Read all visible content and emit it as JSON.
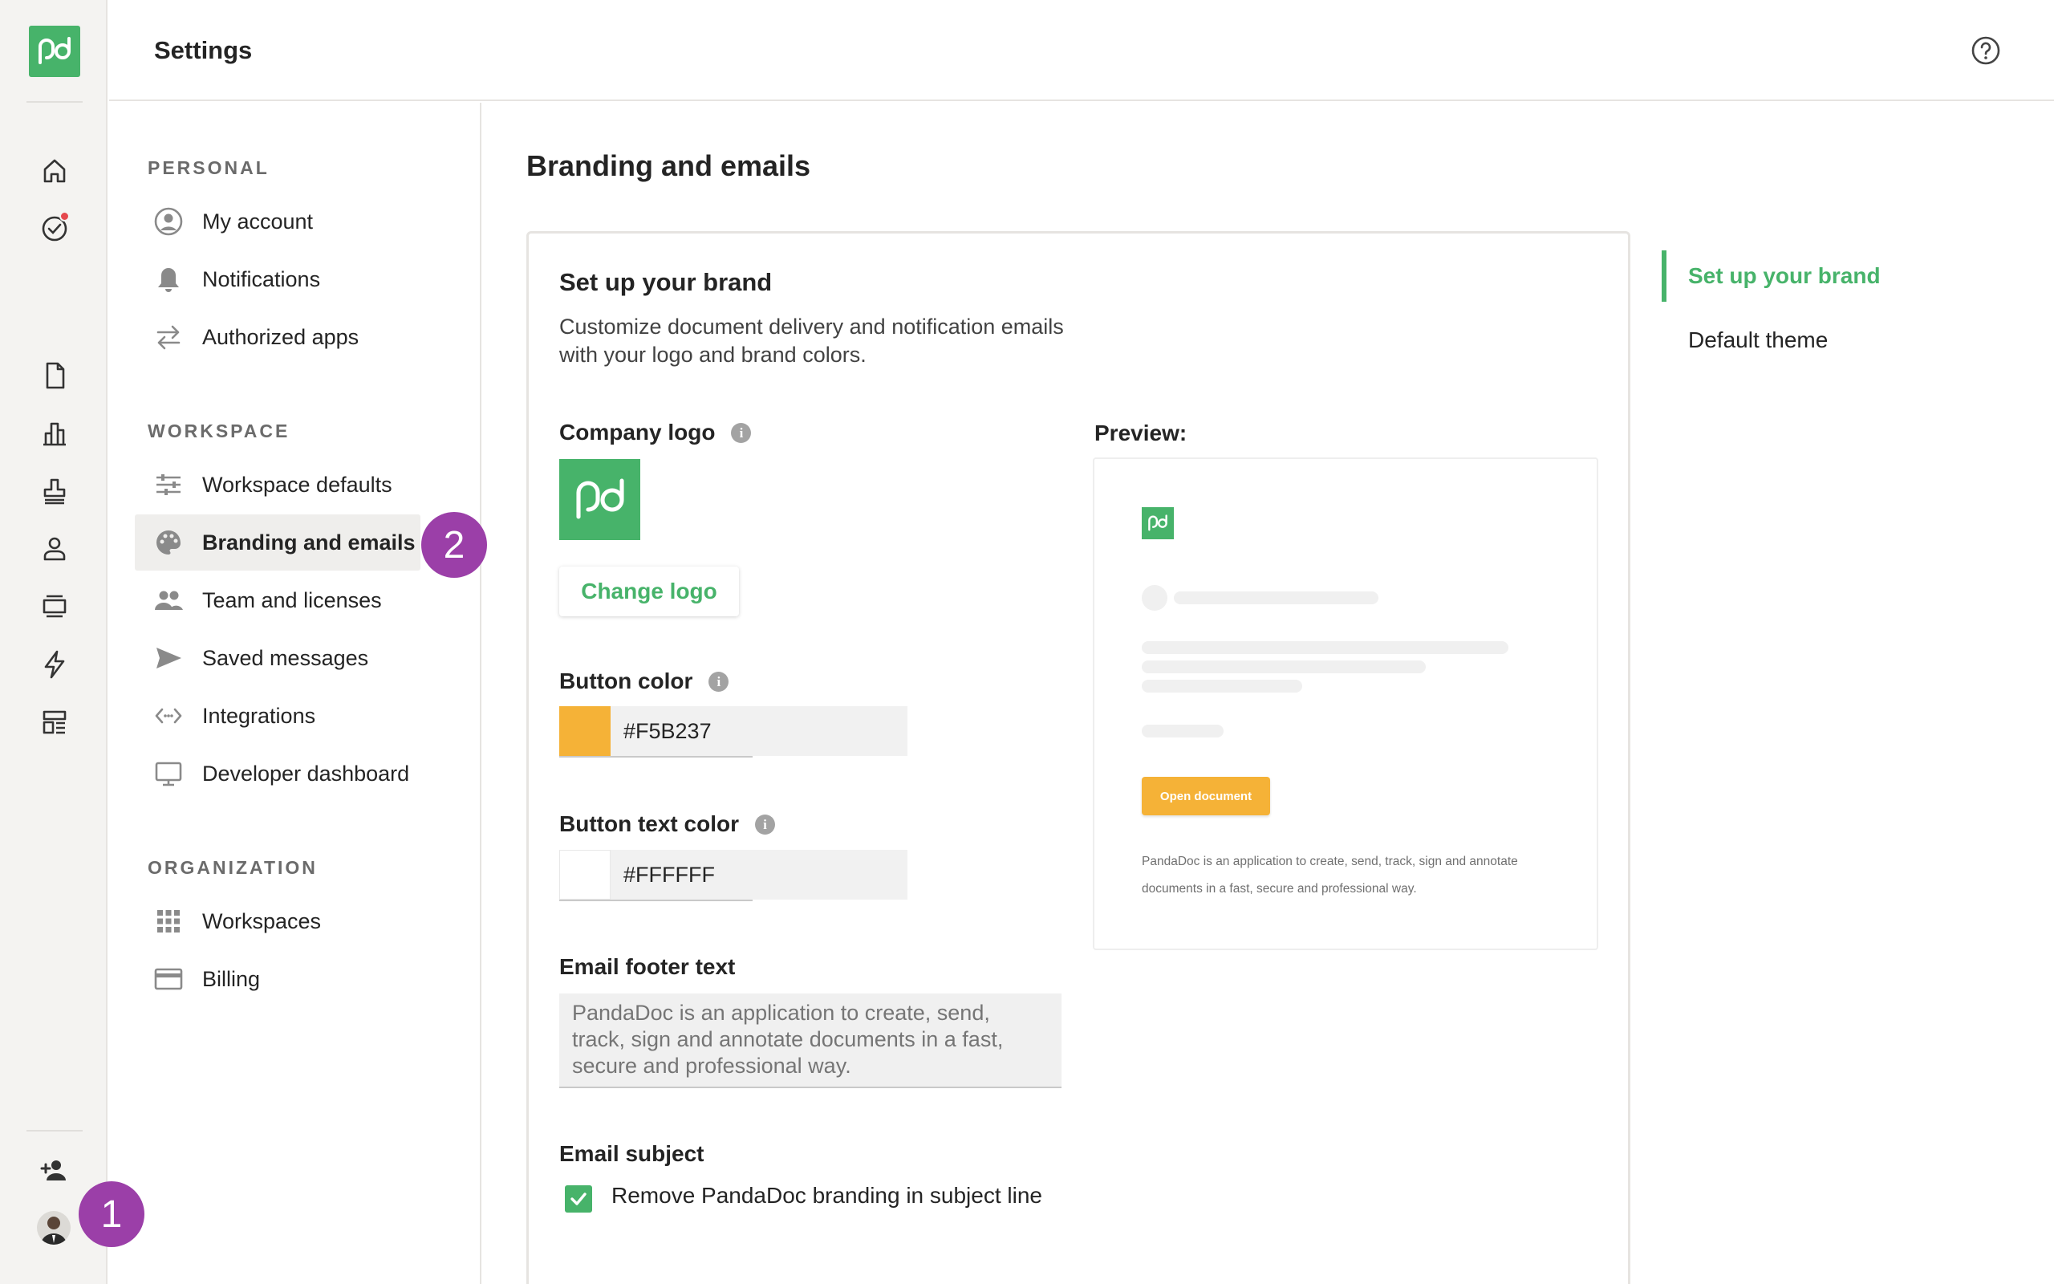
{
  "header": {
    "title": "Settings",
    "help_icon": "help-circle-icon"
  },
  "rail": {
    "items": [
      "home-icon",
      "tasks-icon",
      "documents-icon",
      "reports-icon",
      "stamp-icon",
      "contacts-icon",
      "catalog-icon",
      "automation-icon",
      "templates-icon"
    ],
    "invite_icon": "add-user-icon",
    "step_badge": "1"
  },
  "nav": {
    "personal_label": "PERSONAL",
    "personal_items": [
      "My account",
      "Notifications",
      "Authorized apps"
    ],
    "workspace_label": "WORKSPACE",
    "workspace_items": [
      "Workspace defaults",
      "Branding and emails",
      "Team and licenses",
      "Saved messages",
      "Integrations",
      "Developer dashboard"
    ],
    "organization_label": "ORGANIZATION",
    "organization_items": [
      "Workspaces",
      "Billing"
    ],
    "step_badge": "2",
    "active_item": "Branding and emails"
  },
  "main": {
    "title": "Branding and emails",
    "card": {
      "heading": "Set up your brand",
      "description": "Customize document delivery and notification emails with your logo and brand colors.",
      "company_logo_label": "Company logo",
      "change_logo_label": "Change logo",
      "button_color_label": "Button color",
      "button_color_value": "#F5B237",
      "button_text_color_label": "Button text color",
      "button_text_color_value": "#FFFFFF",
      "email_footer_label": "Email footer text",
      "email_footer_placeholder": "PandaDoc is an application to create, send, track, sign and annotate documents in a fast, secure and professional way.",
      "email_subject_label": "Email subject",
      "remove_branding_label": "Remove PandaDoc branding in subject line",
      "remove_branding_checked": true
    },
    "preview": {
      "label": "Preview:",
      "button_label": "Open document",
      "footer_text": "PandaDoc is an application to create, send, track, sign and annotate documents in a fast, secure and professional way."
    }
  },
  "anchors": {
    "items": [
      "Set up your brand",
      "Default theme"
    ],
    "active": "Set up your brand"
  },
  "colors": {
    "brand_green": "#47b36a",
    "button_color": "#F5B237",
    "step_purple": "#9b3fa8",
    "notification_red": "#e5484d"
  }
}
